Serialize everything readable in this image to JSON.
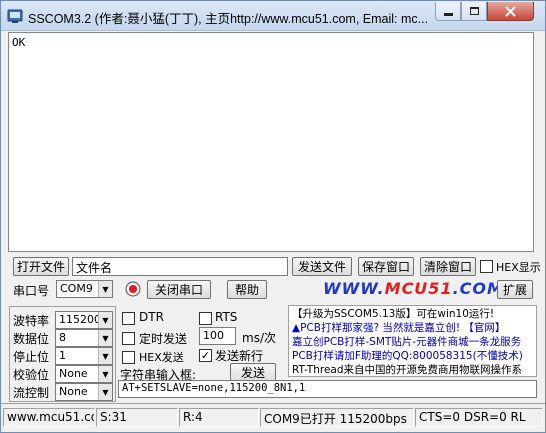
{
  "window": {
    "title": "SSCOM3.2 (作者:聂小猛(丁丁), 主页http://www.mcu51.com,  Email: mc..."
  },
  "receive": {
    "text": "OK"
  },
  "row1": {
    "open_file_label": "打开文件",
    "filename_value": "文件名",
    "send_file_label": "发送文件",
    "save_window_label": "保存窗口",
    "clear_window_label": "清除窗口",
    "hex_display_label": "HEX显示"
  },
  "row2": {
    "port_label": "串口号",
    "port_value": "COM9",
    "close_port_label": "关闭串口",
    "help_label": "帮助",
    "logo_part1": "WWW.",
    "logo_part2": "MCU51",
    "logo_part3": ".COM",
    "expand_label": "扩展"
  },
  "settings": {
    "baud_label": "波特率",
    "baud_value": "115200",
    "databits_label": "数据位",
    "databits_value": "8",
    "stopbits_label": "停止位",
    "stopbits_value": "1",
    "parity_label": "校验位",
    "parity_value": "None",
    "flow_label": "流控制",
    "flow_value": "None"
  },
  "options": {
    "dtr_label": "DTR",
    "rts_label": "RTS",
    "timed_send_label": "定时发送",
    "interval_value": "100",
    "interval_unit": "ms/次",
    "hex_send_label": "HEX发送",
    "send_newline_label": "发送新行",
    "send_newline_checked": true,
    "string_input_label": "字符串输入框:",
    "send_label": "发送",
    "input_value": "AT+SETSLAVE=none,115200_8N1,1"
  },
  "ad": {
    "line1": "【升级为SSCOM5.13版】可在win10运行!",
    "line2": "▲PCB打样那家强? 当然就是嘉立创! 【官网】",
    "line3": "嘉立创PCB打样-SMT贴片-元器件商城一条龙服务",
    "line4": "PCB打样请加F助理的QQ:800058315(不懂技术)",
    "line5": "RT-Thread来自中国的开源免费商用物联网操作系"
  },
  "status": {
    "site": "www.mcu51.cor",
    "sent": "S:31",
    "received": "R:4",
    "port_state": "COM9已打开  115200bps",
    "lines": "CTS=0 DSR=0 RL"
  }
}
